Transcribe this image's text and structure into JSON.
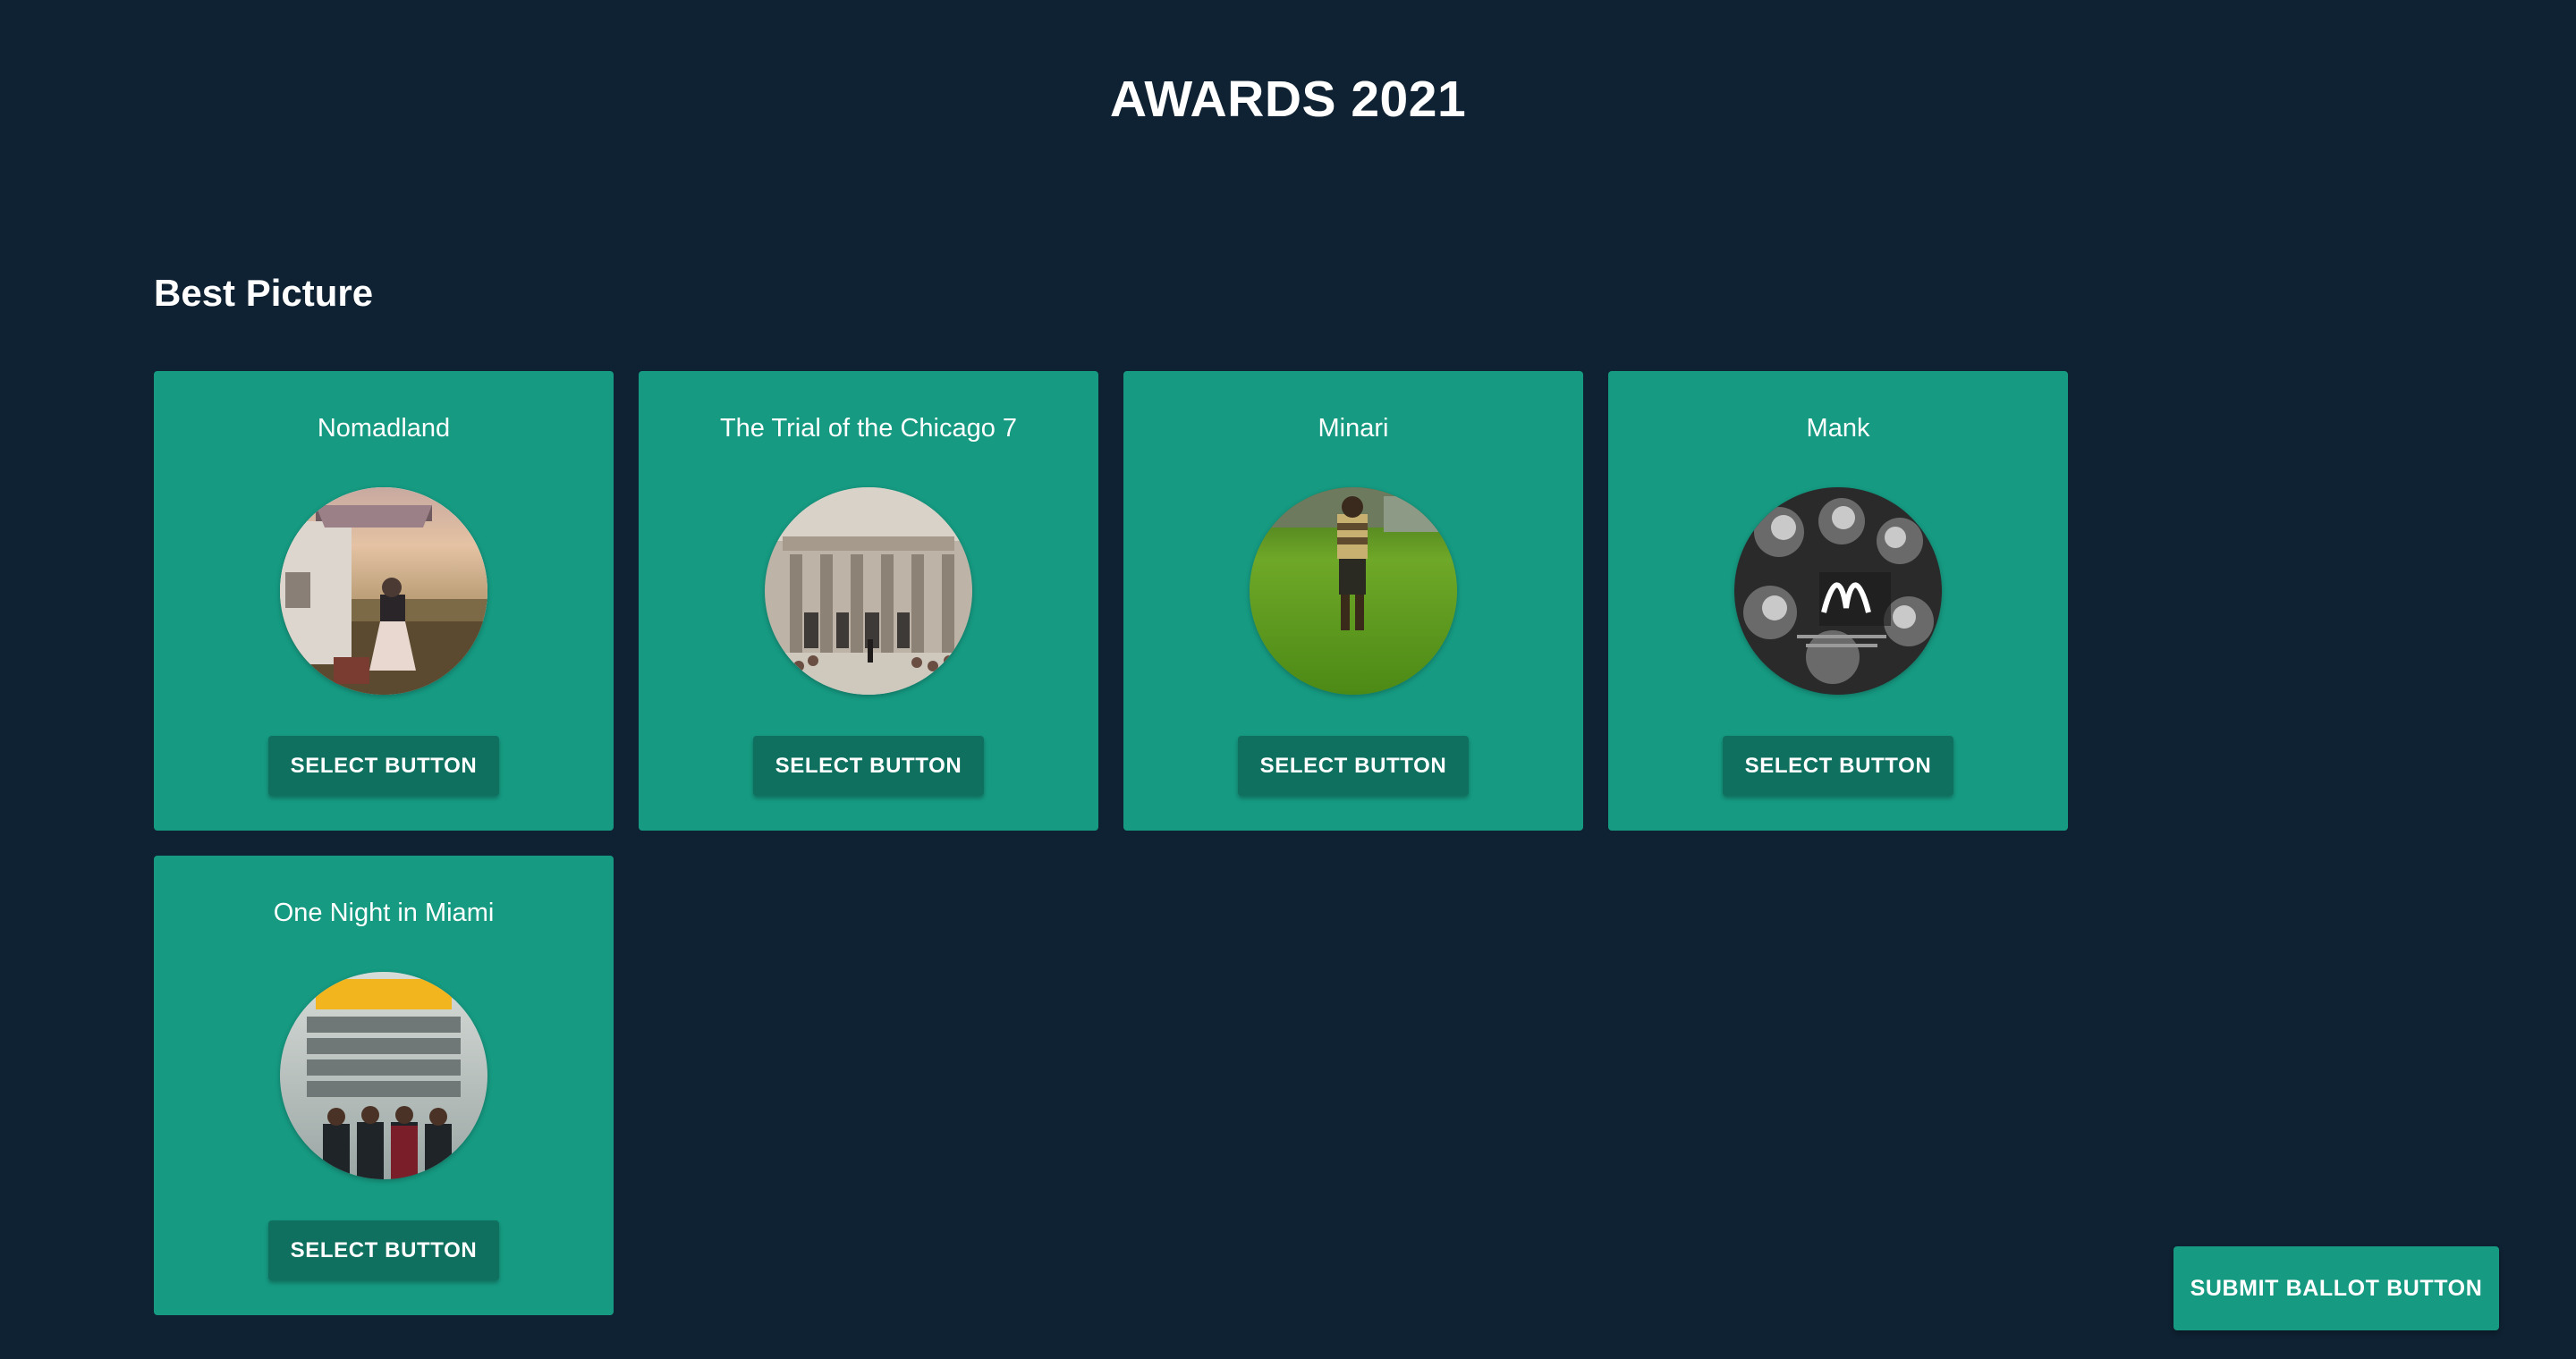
{
  "header": {
    "title": "AWARDS 2021"
  },
  "category": {
    "title": "Best Picture",
    "nominees": [
      {
        "title": "Nomadland",
        "select_label": "SELECT BUTTON",
        "poster_icon": "nomadland-poster"
      },
      {
        "title": "The Trial of the Chicago 7",
        "select_label": "SELECT BUTTON",
        "poster_icon": "trial-of-the-chicago-7-poster"
      },
      {
        "title": "Minari",
        "select_label": "SELECT BUTTON",
        "poster_icon": "minari-poster"
      },
      {
        "title": "Mank",
        "select_label": "SELECT BUTTON",
        "poster_icon": "mank-poster"
      },
      {
        "title": "One Night in Miami",
        "select_label": "SELECT BUTTON",
        "poster_icon": "one-night-in-miami-poster"
      }
    ]
  },
  "footer": {
    "submit_label": "SUBMIT BALLOT BUTTON"
  },
  "colors": {
    "background": "#0f2233",
    "card": "#169a82",
    "button": "#10705f",
    "text": "#ffffff"
  }
}
